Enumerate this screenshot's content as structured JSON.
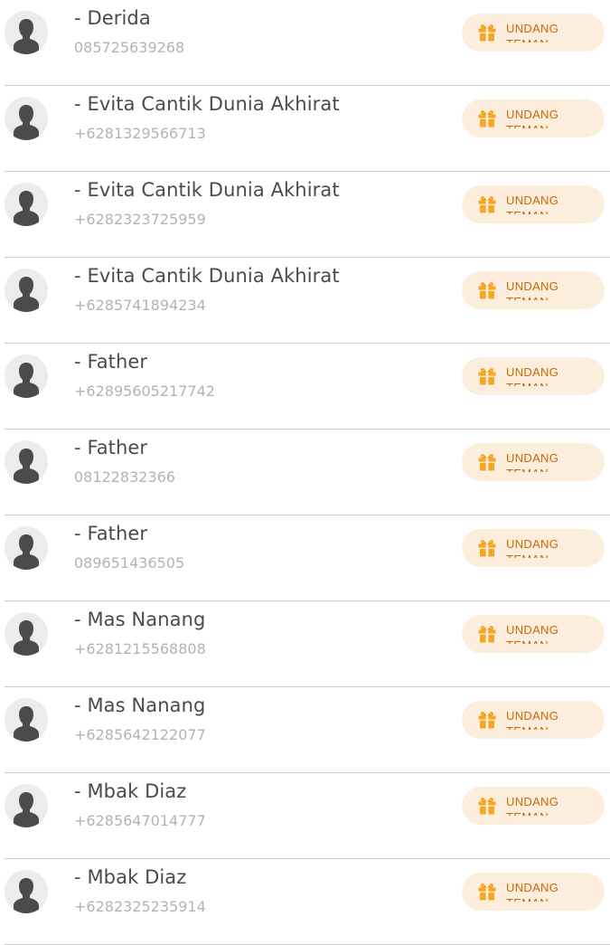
{
  "theme": {
    "accent": "#f5a623",
    "button_bg": "#fdeddd",
    "button_text": "#c56a06"
  },
  "contacts": [
    {
      "name": "- Derida",
      "phone": "085725639268",
      "invite_label": "UNDANG TEMAN",
      "icon": "gift-icon"
    },
    {
      "name": "- Evita Cantik Dunia Akhirat",
      "phone": "+6281329566713",
      "invite_label": "UNDANG TEMAN",
      "icon": "gift-icon"
    },
    {
      "name": "- Evita Cantik Dunia Akhirat",
      "phone": "+6282323725959",
      "invite_label": "UNDANG TEMAN",
      "icon": "gift-icon"
    },
    {
      "name": "- Evita Cantik Dunia Akhirat",
      "phone": "+6285741894234",
      "invite_label": "UNDANG TEMAN",
      "icon": "gift-icon"
    },
    {
      "name": "- Father",
      "phone": "+62895605217742",
      "invite_label": "UNDANG TEMAN",
      "icon": "gift-icon"
    },
    {
      "name": "- Father",
      "phone": "08122832366",
      "invite_label": "UNDANG TEMAN",
      "icon": "gift-icon"
    },
    {
      "name": "- Father",
      "phone": "089651436505",
      "invite_label": "UNDANG TEMAN",
      "icon": "gift-icon"
    },
    {
      "name": "- Mas Nanang",
      "phone": "+6281215568808",
      "invite_label": "UNDANG TEMAN",
      "icon": "gift-icon"
    },
    {
      "name": "- Mas Nanang",
      "phone": "+6285642122077",
      "invite_label": "UNDANG TEMAN",
      "icon": "gift-icon"
    },
    {
      "name": "- Mbak Diaz",
      "phone": "+6285647014777",
      "invite_label": "UNDANG TEMAN",
      "icon": "gift-icon"
    },
    {
      "name": "- Mbak Diaz",
      "phone": "+6282325235914",
      "invite_label": "UNDANG TEMAN",
      "icon": "gift-icon"
    }
  ]
}
